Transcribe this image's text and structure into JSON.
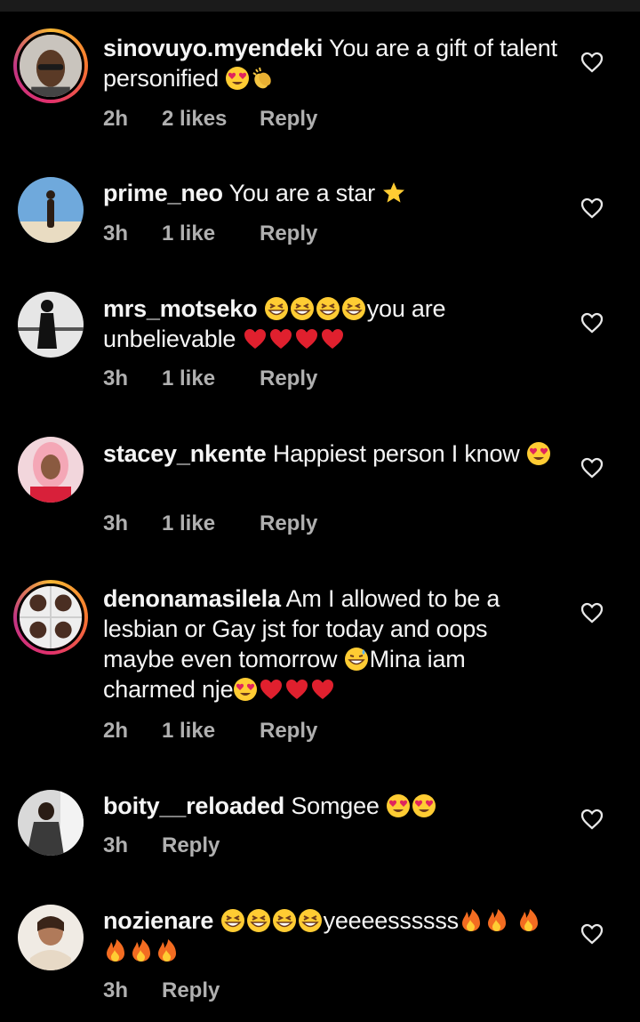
{
  "comments": [
    {
      "username": "sinovuyo.myendeki",
      "text": "You are a gift of talent personified",
      "emojis": [
        "heart-eyes-emoji",
        "clapping-hands-emoji"
      ],
      "time": "2h",
      "likes": "2 likes",
      "reply": "Reply"
    },
    {
      "username": "prime_neo",
      "text": "You are a star",
      "emojis": [
        "star-emoji"
      ],
      "time": "3h",
      "likes": "1 like",
      "reply": "Reply"
    },
    {
      "username": "mrs_motseko",
      "text_after": "you are unbelievable",
      "emojis_before": [
        "grinning-squint-emoji",
        "grinning-squint-emoji",
        "grinning-squint-emoji",
        "grinning-squint-emoji"
      ],
      "emojis": [
        "red-heart-emoji",
        "red-heart-emoji",
        "red-heart-emoji",
        "red-heart-emoji"
      ],
      "time": "3h",
      "likes": "1 like",
      "reply": "Reply"
    },
    {
      "username": "stacey_nkente",
      "text": "Happiest person I know",
      "emojis": [
        "heart-eyes-emoji"
      ],
      "time": "3h",
      "likes": "1 like",
      "reply": "Reply"
    },
    {
      "username": "denonamasilela",
      "text": "Am I allowed to be a lesbian or Gay jst for today and oops maybe even tomorrow",
      "text_after": "Mina iam charmed nje",
      "emojis_mid": [
        "sweat-smile-emoji"
      ],
      "emojis": [
        "heart-eyes-emoji",
        "red-heart-emoji",
        "red-heart-emoji",
        "red-heart-emoji"
      ],
      "time": "2h",
      "likes": "1 like",
      "reply": "Reply"
    },
    {
      "username": "boity__reloaded",
      "text": "Somgee",
      "emojis": [
        "heart-eyes-emoji",
        "heart-eyes-emoji"
      ],
      "time": "3h",
      "reply": "Reply"
    },
    {
      "username": "nozienare",
      "text_after": "yeeeessssss",
      "emojis_before": [
        "grinning-squint-emoji",
        "grinning-squint-emoji",
        "grinning-squint-emoji",
        "grinning-squint-emoji"
      ],
      "emojis": [
        "fire-emoji",
        "fire-emoji",
        "fire-emoji",
        "fire-emoji",
        "fire-emoji",
        "fire-emoji"
      ],
      "time": "3h",
      "reply": "Reply"
    }
  ],
  "icons": {
    "like": "heart-outline-icon"
  },
  "colors": {
    "background": "#000000",
    "text": "#f5f5f5",
    "meta": "#b0b0b0"
  }
}
